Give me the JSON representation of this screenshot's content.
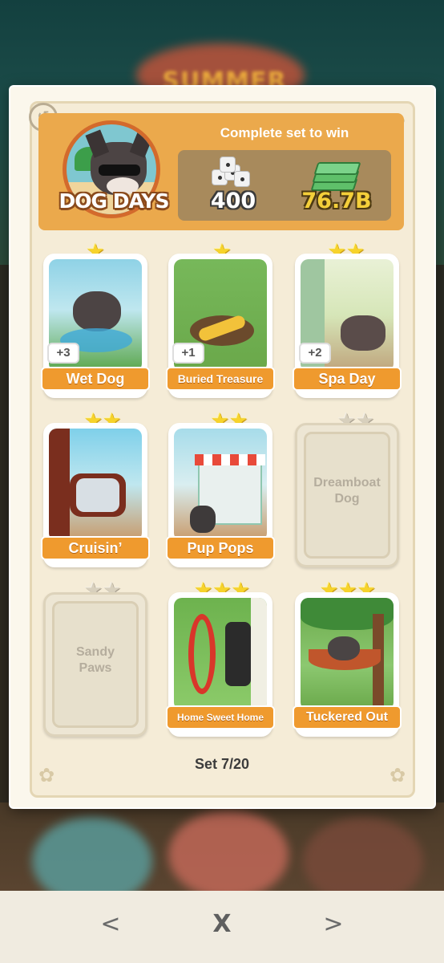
{
  "event": {
    "title": "SUMMER"
  },
  "set": {
    "name": "DOG DAYS",
    "reward_caption": "Complete set to win",
    "reward_dice": "400",
    "reward_money": "76.7B",
    "progress": "Set 7/20"
  },
  "cards": [
    {
      "name": "Wet Dog",
      "stars": 1,
      "count": "+3",
      "collected": true
    },
    {
      "name": "Buried Treasure",
      "stars": 1,
      "count": "+1",
      "collected": true
    },
    {
      "name": "Spa Day",
      "stars": 2,
      "count": "+2",
      "collected": true
    },
    {
      "name": "Cruisin’",
      "stars": 2,
      "count": "",
      "collected": true
    },
    {
      "name": "Pup Pops",
      "stars": 2,
      "count": "",
      "collected": true
    },
    {
      "name": "Dreamboat Dog",
      "stars": 2,
      "count": "",
      "collected": false
    },
    {
      "name": "Sandy Paws",
      "stars": 2,
      "count": "",
      "collected": false
    },
    {
      "name": "Home Sweet Home",
      "stars": 3,
      "count": "",
      "collected": true
    },
    {
      "name": "Tuckered Out",
      "stars": 3,
      "count": "",
      "collected": true
    }
  ],
  "nav": {
    "prev": "<",
    "close": "X",
    "next": ">"
  },
  "colors": {
    "banner": "#eba94c",
    "label": "#ef9a2e",
    "star": "#f7d32b"
  }
}
